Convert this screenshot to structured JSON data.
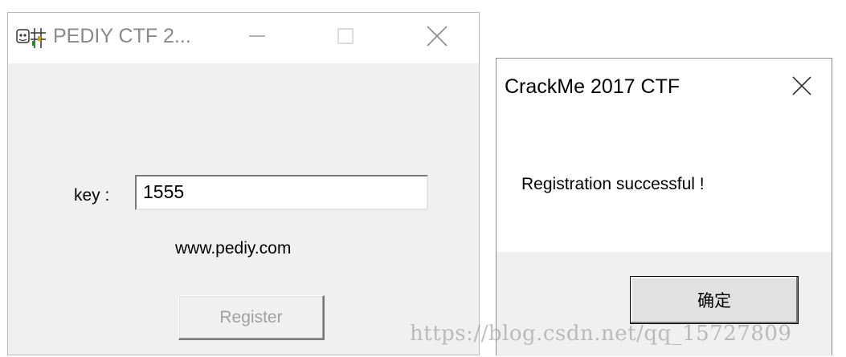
{
  "main_window": {
    "title": "PEDIY CTF 2...",
    "icon": "crackme-app-icon",
    "minimize_icon": "minimize-icon",
    "maximize_icon": "maximize-icon",
    "close_icon": "close-icon",
    "key_label": "key :",
    "key_value": "1555",
    "website": "www.pediy.com",
    "register_label": "Register"
  },
  "message_box": {
    "title": "CrackMe 2017 CTF",
    "close_icon": "close-icon",
    "message": "Registration successful !",
    "ok_label": "确定"
  },
  "watermark": "https://blog.csdn.net/qq_15727809"
}
